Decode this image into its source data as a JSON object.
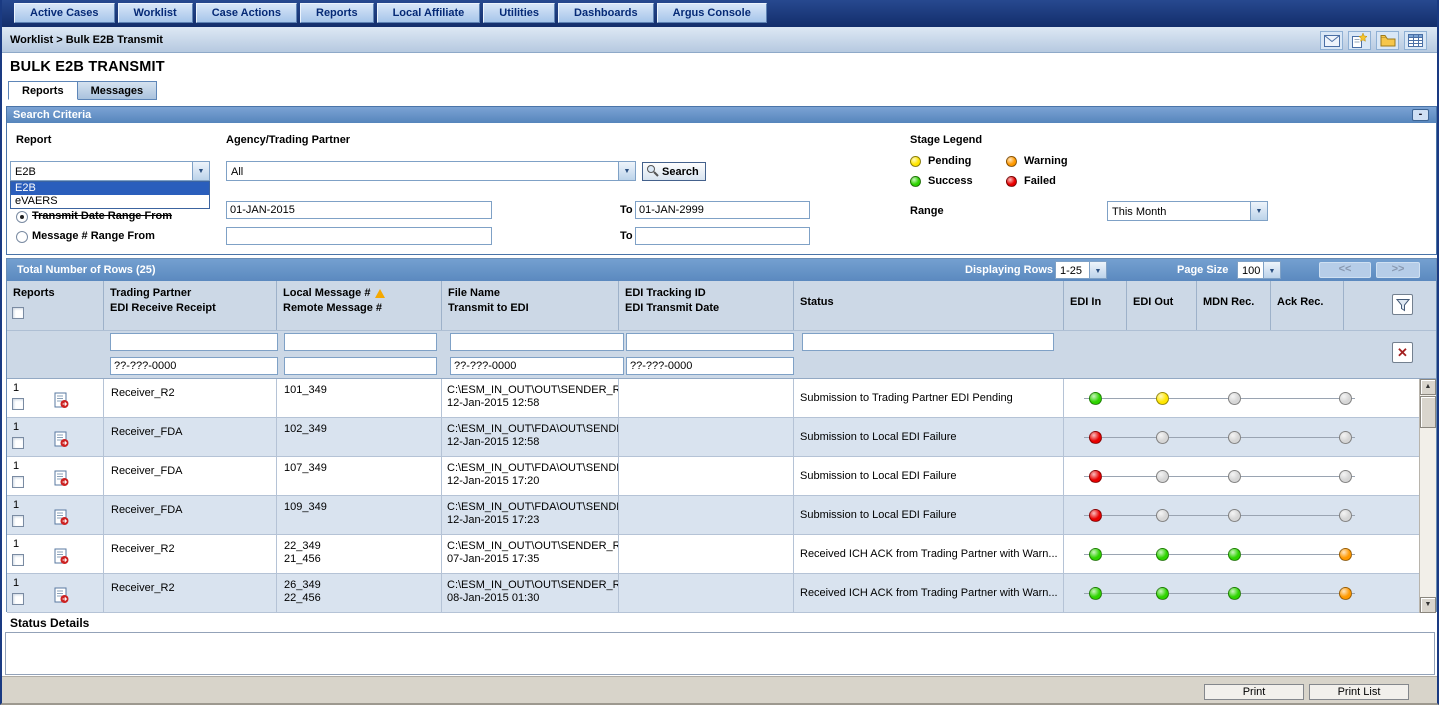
{
  "nav": {
    "items": [
      "Active Cases",
      "Worklist",
      "Case Actions",
      "Reports",
      "Local Affiliate",
      "Utilities",
      "Dashboards",
      "Argus Console"
    ]
  },
  "breadcrumb": {
    "path": "Worklist > Bulk E2B Transmit",
    "icons": [
      "mail-icon",
      "new-note-icon",
      "folder-icon",
      "grid-icon"
    ]
  },
  "page_title": "BULK E2B TRANSMIT",
  "tabs": {
    "reports": "Reports",
    "messages": "Messages"
  },
  "search": {
    "header": "Search Criteria",
    "minimize_label": "-",
    "report_label": "Report",
    "report_value": "E2B",
    "report_options": [
      "E2B",
      "eVAERS"
    ],
    "agency_label": "Agency/Trading Partner",
    "agency_value": "All",
    "search_button": "Search",
    "transmit_label": "Transmit Date Range From",
    "transmit_from": "01-JAN-2015",
    "transmit_to_label": "To",
    "transmit_to": "01-JAN-2999",
    "message_label": "Message # Range From",
    "message_from": "",
    "message_to_label": "To",
    "message_to": "",
    "range_label": "Range",
    "range_value": "This Month",
    "legend": {
      "title": "Stage Legend",
      "items": [
        {
          "label": "Pending",
          "key": "pending"
        },
        {
          "label": "Warning",
          "key": "warning"
        },
        {
          "label": "Success",
          "key": "success"
        },
        {
          "label": "Failed",
          "key": "failed"
        }
      ]
    }
  },
  "stage_colors": {
    "pending": "#ffe600",
    "warning": "#ff9900",
    "success": "#2ed400",
    "failed": "#e80000",
    "none": "#d6d6d6"
  },
  "grid": {
    "total_label": "Total Number of Rows (25)",
    "displaying_label": "Displaying Rows",
    "displaying_value": "1-25",
    "page_size_label": "Page Size",
    "page_size_value": "100",
    "prev_label": "<<",
    "next_label": ">>",
    "columns": {
      "reports": "Reports",
      "trading_1": "Trading Partner",
      "trading_2": "EDI Receive Receipt",
      "local_1": "Local Message #",
      "local_2": "Remote Message #",
      "file_1": "File Name",
      "file_2": "Transmit to EDI",
      "edi_1": "EDI Tracking ID",
      "edi_2": "EDI Transmit Date",
      "status": "Status",
      "edi_in": "EDI In",
      "edi_out": "EDI Out",
      "mdn": "MDN Rec.",
      "ack": "Ack Rec."
    },
    "filters": {
      "trading_filter": "",
      "local_filter": "",
      "file_filter": "",
      "tracking_filter": "",
      "status_filter": "",
      "receipt_mask": "??-???-0000",
      "remote_filter": "",
      "transmit_mask": "??-???-0000",
      "edi_date_mask": "??-???-0000"
    },
    "rows": [
      {
        "num": "1",
        "partner": "Receiver_R2",
        "local": "101_349",
        "remote": "",
        "file": "C:\\ESM_IN_OUT\\OUT\\SENDER_R...",
        "transmit": "12-Jan-2015 12:58",
        "tracking": "",
        "tdate": "",
        "status": "Submission to Trading Partner EDI Pending",
        "stages": [
          "success",
          "pending",
          "none",
          "none"
        ]
      },
      {
        "num": "1",
        "partner": "Receiver_FDA",
        "local": "102_349",
        "remote": "",
        "file": "C:\\ESM_IN_OUT\\FDA\\OUT\\SENDE...",
        "transmit": "12-Jan-2015 12:58",
        "tracking": "",
        "tdate": "",
        "status": "Submission to Local EDI Failure",
        "stages": [
          "failed",
          "none",
          "none",
          "none"
        ]
      },
      {
        "num": "1",
        "partner": "Receiver_FDA",
        "local": "107_349",
        "remote": "",
        "file": "C:\\ESM_IN_OUT\\FDA\\OUT\\SENDE...",
        "transmit": "12-Jan-2015 17:20",
        "tracking": "",
        "tdate": "",
        "status": "Submission to Local EDI Failure",
        "stages": [
          "failed",
          "none",
          "none",
          "none"
        ]
      },
      {
        "num": "1",
        "partner": "Receiver_FDA",
        "local": "109_349",
        "remote": "",
        "file": "C:\\ESM_IN_OUT\\FDA\\OUT\\SENDE...",
        "transmit": "12-Jan-2015 17:23",
        "tracking": "",
        "tdate": "",
        "status": "Submission to Local EDI Failure",
        "stages": [
          "failed",
          "none",
          "none",
          "none"
        ]
      },
      {
        "num": "1",
        "partner": "Receiver_R2",
        "local": "22_349",
        "remote": "21_456",
        "file": "C:\\ESM_IN_OUT\\OUT\\SENDER_R...",
        "transmit": "07-Jan-2015 17:35",
        "tracking": "",
        "tdate": "",
        "status": "Received ICH ACK from Trading Partner with Warn...",
        "stages": [
          "success",
          "success",
          "success",
          "warning"
        ]
      },
      {
        "num": "1",
        "partner": "Receiver_R2",
        "local": "26_349",
        "remote": "22_456",
        "file": "C:\\ESM_IN_OUT\\OUT\\SENDER_R...",
        "transmit": "08-Jan-2015 01:30",
        "tracking": "",
        "tdate": "",
        "status": "Received ICH ACK from Trading Partner with Warn...",
        "stages": [
          "success",
          "success",
          "success",
          "warning"
        ]
      }
    ]
  },
  "status_details": {
    "title": "Status Details",
    "content": ""
  },
  "footer": {
    "print": "Print",
    "print_list": "Print List"
  }
}
